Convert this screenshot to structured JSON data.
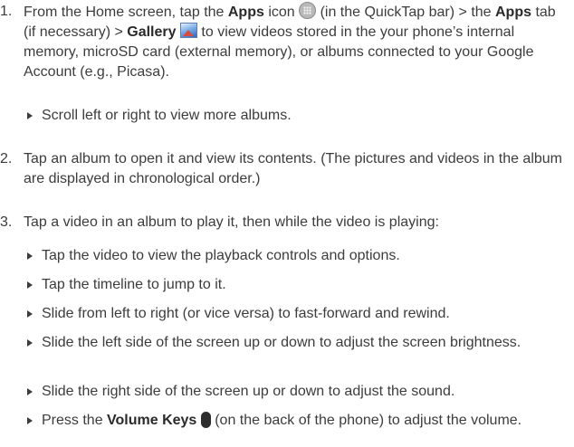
{
  "steps": [
    {
      "number": "1.",
      "parts": {
        "p1": "From the Home screen, tap the ",
        "b1": "Apps",
        "p2": " icon ",
        "p3": " (in the QuickTap bar) > the ",
        "b2": "Apps",
        "p4": " tab (if necessary) > ",
        "b3": "Gallery",
        "p5": " to view videos stored in the your phone’s internal memory, microSD card (external memory), or albums connected to your Google Account (e.g., Picasa)."
      }
    },
    {
      "number": "2.",
      "text": "Tap an album to open it and view its contents. (The pictures and videos in the album are displayed in chronological order.)"
    },
    {
      "number": "3.",
      "text": "Tap a video in an album to play it, then while the video is playing:"
    }
  ],
  "step1_bullets": [
    "Scroll left or right to view more albums."
  ],
  "step3_bullets": [
    "Tap the video to view the playback controls and options.",
    "Tap the timeline to jump to it.",
    "Slide from left to right (or vice versa) to fast-forward and rewind.",
    "Slide the left side of the screen up or down to adjust the screen brightness.",
    "Slide the right side of the screen up or down to adjust the sound."
  ],
  "last_bullet": {
    "p1": "Press the ",
    "b1": "Volume Keys",
    "p2": " (on the back of the phone) to adjust the volume."
  },
  "icons": [
    "apps-icon",
    "gallery-icon",
    "volume-keys-icon"
  ]
}
